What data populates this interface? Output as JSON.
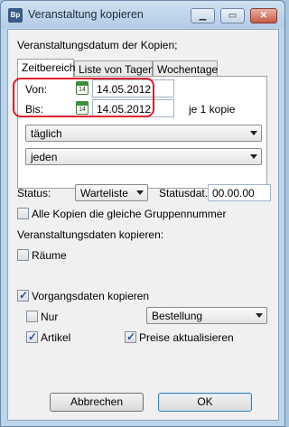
{
  "window": {
    "title": "Veranstaltung kopieren",
    "app_icon_text": "Bp"
  },
  "heading": "Veranstaltungsdatum der Kopien;",
  "tabs": [
    "Zeitbereich",
    "Liste von Tagen",
    "Wochentage"
  ],
  "zeitbereich": {
    "von_label": "Von:",
    "von_value": "14.05.2012",
    "bis_label": "Bis:",
    "bis_value": "14.05.2012",
    "calendar_day": "14",
    "count_text": "je 1 kopie",
    "frequency": "täglich",
    "interval": "jeden"
  },
  "status": {
    "label": "Status:",
    "value": "Warteliste",
    "date_label": "Statusdat.:",
    "date_value": "00.00.00"
  },
  "same_group_label": "Alle Kopien die gleiche Gruppennummer",
  "copy_data_heading": "Veranstaltungsdaten kopieren:",
  "raeume_label": "Räume",
  "vorgangsdaten_label": "Vorgangsdaten kopieren",
  "nur_label": "Nur",
  "nur_select": "Bestellung",
  "artikel_label": "Artikel",
  "preise_label": "Preise aktualisieren",
  "buttons": {
    "cancel": "Abbrechen",
    "ok": "OK"
  },
  "checked": {
    "same_group": false,
    "raeume": false,
    "vorgangsdaten": true,
    "nur": false,
    "artikel": true,
    "preise": true
  }
}
